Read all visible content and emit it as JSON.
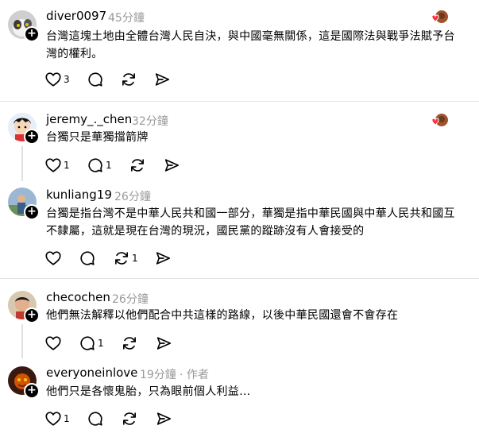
{
  "posts": [
    {
      "username": "diver0097",
      "time": "45分鐘",
      "text_lines": [
        "台灣這塊土地由全體台灣人民自決，與中國毫無關係，這是國際法與戰爭法賦予台",
        "灣的權利。"
      ],
      "likes": "3",
      "replies": "",
      "reposts": ""
    },
    {
      "username": "jeremy_._chen",
      "time": "32分鐘",
      "text_lines": [
        "台獨只是華獨擋箭牌"
      ],
      "likes": "1",
      "replies": "1",
      "reposts": ""
    },
    {
      "username": "kunliang19",
      "time": "26分鐘",
      "text_lines": [
        "台獨是指台灣不是中華人民共和國一部分，華獨是指中華民國與中華人民共和國互",
        "不隸屬，這就是現在台灣的現況，國民黨的蹤跡沒有人會接受的"
      ],
      "likes": "",
      "replies": "",
      "reposts": "1"
    },
    {
      "username": "checochen",
      "time": "26分鐘",
      "text_lines": [
        "他們無法解釋以他們配合中共這樣的路線，以後中華民國還會不會存在"
      ],
      "likes": "",
      "replies": "1",
      "reposts": ""
    },
    {
      "username": "everyoneinlove",
      "time": "19分鐘",
      "author_tag": "· 作者",
      "text_lines": [
        "他們只是各懷鬼胎，只為眼前個人利益…"
      ],
      "likes": "1",
      "replies": "",
      "reposts": ""
    }
  ],
  "icons": {
    "like": "heart-icon",
    "reply": "comment-icon",
    "repost": "repost-icon",
    "share": "send-icon",
    "follow": "plus-icon"
  },
  "colors": {
    "timestamp": "#999999",
    "divider": "#e5e5e5",
    "badge_heart": "#ff3040"
  }
}
